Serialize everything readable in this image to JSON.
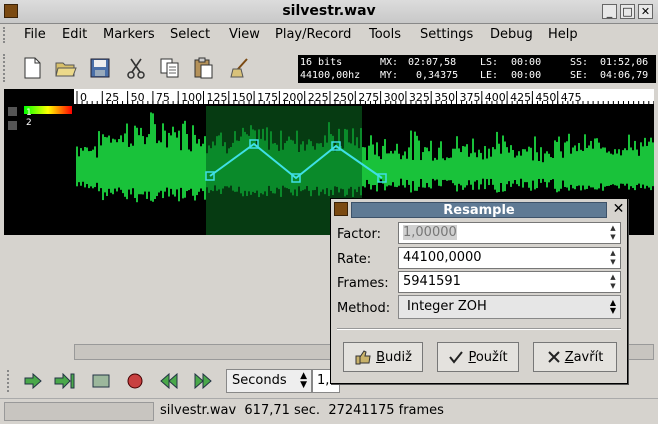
{
  "window": {
    "title": "silvestr.wav",
    "minimize_glyph": "_",
    "maximize_glyph": "□",
    "close_glyph": "✕"
  },
  "menu": [
    {
      "label": "File"
    },
    {
      "label": "Edit"
    },
    {
      "label": "Markers"
    },
    {
      "label": "Select"
    },
    {
      "label": "View"
    },
    {
      "label": "Play/Record"
    },
    {
      "label": "Tools"
    },
    {
      "label": "Settings"
    },
    {
      "label": "Debug"
    },
    {
      "label": "Help"
    }
  ],
  "toolbar_icons": [
    "new-file-icon",
    "open-folder-icon",
    "save-disk-icon",
    "cut-scissors-icon",
    "copy-icon",
    "paste-icon",
    "clear-broom-icon"
  ],
  "info": {
    "bits": "16 bits",
    "rate": "44100,00hz",
    "mx_label": "MX:",
    "mx": "02:07,58",
    "my_label": "MY:",
    "my": "0,34375",
    "ls_label": "LS:",
    "ls": "00:00",
    "le_label": "LE:",
    "le": "00:00",
    "ss_label": "SS:",
    "ss": "01:52,06",
    "se_label": "SE:",
    "se": "04:06,79"
  },
  "channels": {
    "ch1": "1",
    "ch2": "2"
  },
  "ruler_ticks": [
    "0",
    "25",
    "50",
    "75",
    "100",
    "125",
    "150",
    "175",
    "200",
    "225",
    "250",
    "275",
    "300",
    "325",
    "350",
    "375",
    "400",
    "425",
    "450",
    "475"
  ],
  "playback": {
    "icons": [
      "play-icon",
      "play-to-end-icon",
      "stop-icon",
      "record-icon",
      "rewind-icon",
      "fast-forward-icon"
    ],
    "units": "Seconds",
    "position": "1,0"
  },
  "status": {
    "text": "silvestr.wav  617,71 sec.  27241175 frames"
  },
  "dialog": {
    "title": "Resample",
    "close_glyph": "✕",
    "factor_label": "Factor:",
    "factor": "1,00000",
    "rate_label": "Rate:",
    "rate": "44100,0000",
    "frames_label": "Frames:",
    "frames": "5941591",
    "method_label": "Method:",
    "method": "Integer ZOH",
    "btn_ok_pre": "",
    "btn_ok_ul": "B",
    "btn_ok_post": "udiž",
    "btn_apply_pre": "",
    "btn_apply_ul": "P",
    "btn_apply_post": "oužít",
    "btn_close_pre": "",
    "btn_close_ul": "Z",
    "btn_close_post": "avřít"
  },
  "colors": {
    "wave": "#19c23a",
    "wave_selected": "#0a8a2a",
    "envelope": "#3fe0e6",
    "dialog_title": "#5f7a94"
  }
}
